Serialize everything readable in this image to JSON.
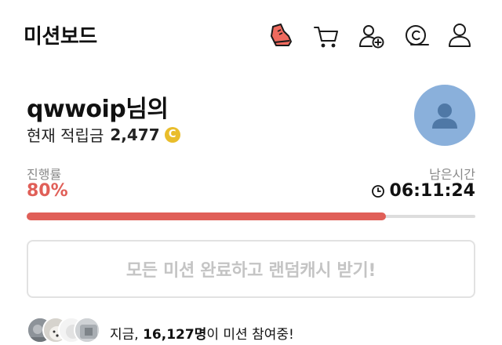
{
  "header": {
    "title": "미션보드",
    "icons": [
      "shoe-icon",
      "cart-icon",
      "add-user-icon",
      "coin-c-icon",
      "user-icon"
    ]
  },
  "profile": {
    "username": "qwwoip",
    "username_suffix": "님의",
    "points_label": "현재 적립금",
    "points_value": "2,477",
    "coin_symbol": "C"
  },
  "progress": {
    "label": "진행률",
    "value_text": "80%",
    "fraction": 0.8,
    "time_label": "남은시간",
    "time_value": "06:11:24"
  },
  "cta": {
    "label": "모든 미션 완료하고 랜덤캐시 받기!"
  },
  "participants": {
    "prefix": "지금, ",
    "count": "16,127명",
    "suffix": "이 미션 참여중!"
  },
  "colors": {
    "accent": "#e05f58",
    "coin": "#e9bd2b",
    "avatar_bg": "#8ab0db",
    "track_bg": "#dddddd",
    "cta_text": "#c4c4c4"
  }
}
